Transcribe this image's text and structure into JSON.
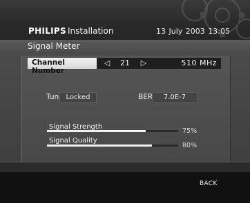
{
  "header": {
    "brand": "PHILIPS",
    "section": "Installation",
    "date": "13 July 2003",
    "time": "13:05"
  },
  "page": {
    "title": "Signal Meter"
  },
  "channel": {
    "label": "Channel Number",
    "number": "21",
    "frequency": "510 MHz"
  },
  "status": {
    "tuner_label": "Tuner",
    "tuner_value": "Locked",
    "ber_label": "BER",
    "ber_value": "7.0E-7"
  },
  "meters": {
    "strength_label": "Signal Strength",
    "strength_percent": 75,
    "strength_text": "75%",
    "quality_label": "Signal Quality",
    "quality_percent": 80,
    "quality_text": "80%"
  },
  "footer": {
    "back_label": "BACK"
  },
  "colors": {
    "bar_fill": "#f2f2f2",
    "highlight": "#e6e6e6"
  },
  "icons": {
    "decor": "gear-icon",
    "prev": "arrow-left-icon",
    "next": "arrow-right-icon"
  }
}
